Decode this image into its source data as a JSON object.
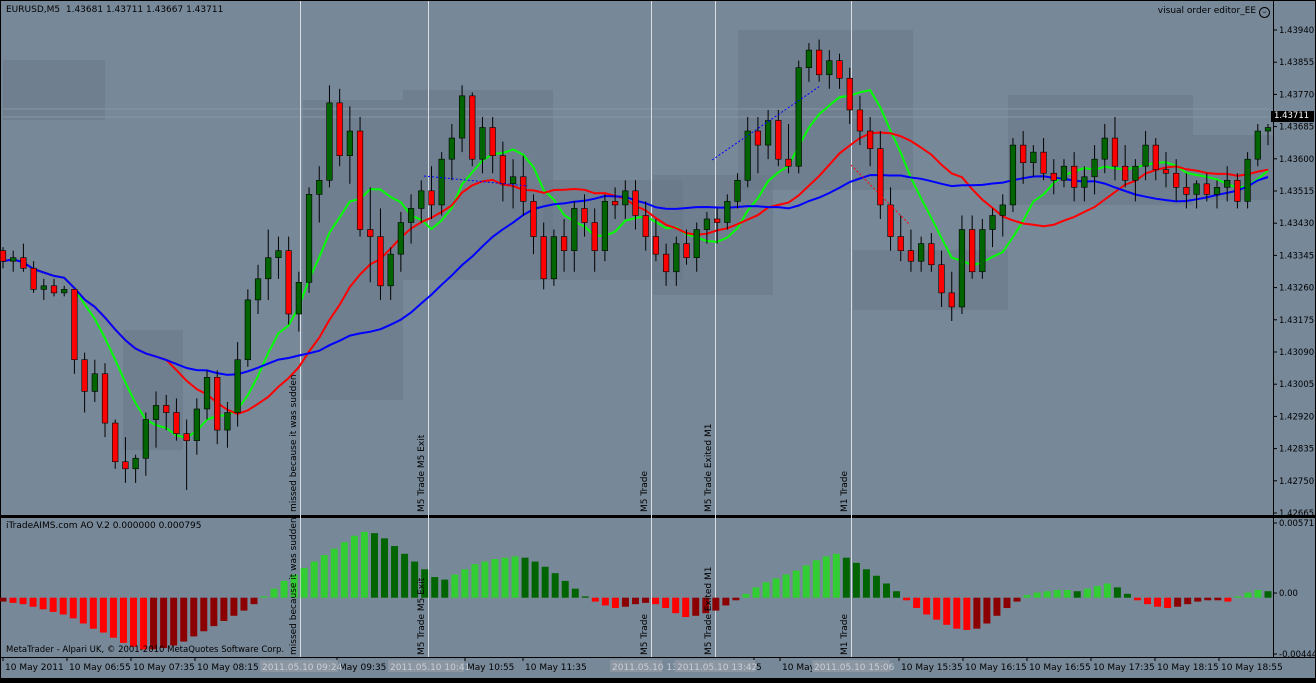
{
  "chart_header": {
    "symbol": "EURUSD,M5",
    "ohlc": "1.43681 1.43711 1.43667 1.43711",
    "editor_label": "visual order editor_EE",
    "editor_icon": "smiley-icon"
  },
  "indicator_header": "iTradeAIMS.com AO V.2 0.000000 0.000795",
  "copyright": "MetaTrader - Alpari UK, © 2001-2010 MetaQuotes Software Corp.",
  "current_price": "1.43711",
  "colors": {
    "background": "#778899",
    "bull_candle": "#006400",
    "bear_candle": "#ff0000",
    "green_ma": "#00ff00",
    "red_ma": "#ff0000",
    "blue_ma": "#0000ff",
    "ao_up": "#32cd32",
    "ao_up_dark": "#006400",
    "ao_down": "#ff0000",
    "ao_down_dark": "#8b0000",
    "zone": "#6a7888"
  },
  "price_axis": {
    "ticks": [
      "1.43940",
      "1.43855",
      "1.43770",
      "1.43685",
      "1.43600",
      "1.43515",
      "1.43430",
      "1.43345",
      "1.43260",
      "1.43175",
      "1.43090",
      "1.43005",
      "1.42920",
      "1.42835",
      "1.42750",
      "1.42665"
    ]
  },
  "ao_axis": {
    "ticks": [
      "0.00571",
      "0.00",
      "-0.00444"
    ]
  },
  "time_axis": {
    "labels": [
      "10 May 2011",
      "10 May 06:55",
      "10 May 07:35",
      "10 May 08:15",
      "May 09:35",
      "May 10:55",
      "10 May 11:35",
      "5",
      "10 May 1",
      "10 May 15:35",
      "10 May 16:15",
      "10 May 16:55",
      "10 May 17:35",
      "10 May 18:15",
      "10 May 18:55"
    ],
    "stamps": [
      "2011.05.10 09:24",
      "2011.05.10 10:41",
      "2011.05.10 13",
      "2011.05.10 13:42",
      "2011.05.10 15:06"
    ]
  },
  "annotations": {
    "vlines": [
      {
        "label": "missed because it was sudden"
      },
      {
        "label": "M5 Trade M5 Exit"
      },
      {
        "label": "M5 Trade"
      },
      {
        "label": "M5 Trade Exited M1"
      },
      {
        "label": "M1 Trade"
      }
    ]
  },
  "chart_data": [
    {
      "type": "candlestick",
      "symbol": "EURUSD",
      "timeframe": "M5",
      "title": "EURUSD,M5",
      "ylim": [
        1.4262,
        1.4399
      ],
      "series": [
        {
          "name": "OHLC",
          "values": [
            [
              1.4336,
              1.4337,
              1.4331,
              1.4333
            ],
            [
              1.4333,
              1.4336,
              1.433,
              1.4334
            ],
            [
              1.4334,
              1.4338,
              1.433,
              1.4331
            ],
            [
              1.4331,
              1.4333,
              1.4324,
              1.4325
            ],
            [
              1.4325,
              1.4328,
              1.4322,
              1.4326
            ],
            [
              1.4326,
              1.4328,
              1.4323,
              1.4324
            ],
            [
              1.4324,
              1.4326,
              1.4323,
              1.4325
            ],
            [
              1.4325,
              1.4325,
              1.4301,
              1.4305
            ],
            [
              1.4305,
              1.4307,
              1.429,
              1.4296
            ],
            [
              1.4296,
              1.4305,
              1.4293,
              1.4301
            ],
            [
              1.4301,
              1.4304,
              1.4283,
              1.4287
            ],
            [
              1.4287,
              1.4288,
              1.4274,
              1.4276
            ],
            [
              1.4276,
              1.4283,
              1.427,
              1.4274
            ],
            [
              1.4274,
              1.4278,
              1.427,
              1.4277
            ],
            [
              1.4277,
              1.429,
              1.4272,
              1.4288
            ],
            [
              1.4288,
              1.4296,
              1.428,
              1.4292
            ],
            [
              1.4292,
              1.4295,
              1.4285,
              1.429
            ],
            [
              1.429,
              1.4294,
              1.4282,
              1.4284
            ],
            [
              1.4284,
              1.4288,
              1.4268,
              1.4282
            ],
            [
              1.4282,
              1.4294,
              1.4278,
              1.4291
            ],
            [
              1.4291,
              1.4302,
              1.4288,
              1.43
            ],
            [
              1.43,
              1.4302,
              1.4281,
              1.4285
            ],
            [
              1.4285,
              1.4293,
              1.428,
              1.429
            ],
            [
              1.429,
              1.431,
              1.4286,
              1.4305
            ],
            [
              1.4305,
              1.4325,
              1.4303,
              1.4322
            ],
            [
              1.4322,
              1.4332,
              1.4318,
              1.4328
            ],
            [
              1.4328,
              1.4342,
              1.4322,
              1.4334
            ],
            [
              1.4334,
              1.434,
              1.4328,
              1.4336
            ],
            [
              1.4336,
              1.434,
              1.4315,
              1.4318
            ],
            [
              1.4318,
              1.433,
              1.4313,
              1.4327
            ],
            [
              1.4327,
              1.4354,
              1.4324,
              1.4352
            ],
            [
              1.4352,
              1.436,
              1.4344,
              1.4356
            ],
            [
              1.4356,
              1.4383,
              1.4354,
              1.4378
            ],
            [
              1.4378,
              1.4382,
              1.436,
              1.4363
            ],
            [
              1.4363,
              1.4377,
              1.4355,
              1.437
            ],
            [
              1.437,
              1.4374,
              1.434,
              1.4342
            ],
            [
              1.4342,
              1.4354,
              1.4327,
              1.434
            ],
            [
              1.434,
              1.4348,
              1.4322,
              1.4326
            ],
            [
              1.4326,
              1.4337,
              1.4322,
              1.4335
            ],
            [
              1.4335,
              1.4347,
              1.433,
              1.4344
            ],
            [
              1.4344,
              1.4352,
              1.4338,
              1.4348
            ],
            [
              1.4348,
              1.4356,
              1.4344,
              1.4353
            ],
            [
              1.4353,
              1.436,
              1.4345,
              1.4349
            ],
            [
              1.4349,
              1.4364,
              1.4346,
              1.4362
            ],
            [
              1.4362,
              1.4372,
              1.4356,
              1.4368
            ],
            [
              1.4368,
              1.4383,
              1.4364,
              1.438
            ],
            [
              1.438,
              1.4381,
              1.436,
              1.4362
            ],
            [
              1.4362,
              1.4374,
              1.4358,
              1.4371
            ],
            [
              1.4371,
              1.4374,
              1.4358,
              1.4363
            ],
            [
              1.4363,
              1.4367,
              1.435,
              1.4355
            ],
            [
              1.4355,
              1.4362,
              1.4348,
              1.4357
            ],
            [
              1.4357,
              1.4363,
              1.4346,
              1.435
            ],
            [
              1.435,
              1.4352,
              1.4335,
              1.434
            ],
            [
              1.434,
              1.4344,
              1.4325,
              1.4328
            ],
            [
              1.4328,
              1.4342,
              1.4326,
              1.434
            ],
            [
              1.434,
              1.4345,
              1.433,
              1.4336
            ],
            [
              1.4336,
              1.435,
              1.433,
              1.4348
            ],
            [
              1.4348,
              1.4352,
              1.434,
              1.4344
            ],
            [
              1.4344,
              1.4348,
              1.433,
              1.4336
            ],
            [
              1.4336,
              1.4352,
              1.4333,
              1.435
            ],
            [
              1.435,
              1.4354,
              1.4345,
              1.4349
            ],
            [
              1.4349,
              1.4356,
              1.4345,
              1.4353
            ],
            [
              1.4353,
              1.4356,
              1.4342,
              1.4346
            ],
            [
              1.4346,
              1.435,
              1.4336,
              1.434
            ],
            [
              1.434,
              1.4345,
              1.4333,
              1.4335
            ],
            [
              1.4335,
              1.4338,
              1.4326,
              1.433
            ],
            [
              1.433,
              1.434,
              1.4326,
              1.4338
            ],
            [
              1.4338,
              1.4342,
              1.4332,
              1.4334
            ],
            [
              1.4334,
              1.4344,
              1.433,
              1.4342
            ],
            [
              1.4342,
              1.4347,
              1.4338,
              1.4345
            ],
            [
              1.4345,
              1.4348,
              1.4338,
              1.4344
            ],
            [
              1.4344,
              1.4352,
              1.4342,
              1.435
            ],
            [
              1.435,
              1.4358,
              1.4348,
              1.4356
            ],
            [
              1.4356,
              1.4374,
              1.4354,
              1.437
            ],
            [
              1.437,
              1.4374,
              1.4358,
              1.4366
            ],
            [
              1.4366,
              1.4376,
              1.4362,
              1.4373
            ],
            [
              1.4373,
              1.4376,
              1.436,
              1.4362
            ],
            [
              1.4362,
              1.4372,
              1.4358,
              1.436
            ],
            [
              1.436,
              1.439,
              1.4358,
              1.4388
            ],
            [
              1.4388,
              1.4395,
              1.4384,
              1.4393
            ],
            [
              1.4393,
              1.4396,
              1.4384,
              1.4386
            ],
            [
              1.4386,
              1.4393,
              1.4382,
              1.439
            ],
            [
              1.439,
              1.4392,
              1.4382,
              1.4385
            ],
            [
              1.4385,
              1.4388,
              1.4372,
              1.4376
            ],
            [
              1.4376,
              1.438,
              1.4366,
              1.437
            ],
            [
              1.437,
              1.4374,
              1.436,
              1.4365
            ],
            [
              1.4365,
              1.437,
              1.4345,
              1.4349
            ],
            [
              1.4349,
              1.4354,
              1.4336,
              1.434
            ],
            [
              1.434,
              1.4346,
              1.4333,
              1.4336
            ],
            [
              1.4336,
              1.4342,
              1.433,
              1.4333
            ],
            [
              1.4333,
              1.434,
              1.433,
              1.4338
            ],
            [
              1.4338,
              1.4341,
              1.433,
              1.4332
            ],
            [
              1.4332,
              1.4336,
              1.432,
              1.4324
            ],
            [
              1.4324,
              1.433,
              1.4316,
              1.432
            ],
            [
              1.432,
              1.4346,
              1.4318,
              1.4342
            ],
            [
              1.4342,
              1.4346,
              1.4328,
              1.433
            ],
            [
              1.433,
              1.4345,
              1.4328,
              1.4342
            ],
            [
              1.4342,
              1.4348,
              1.4337,
              1.4346
            ],
            [
              1.4346,
              1.4352,
              1.434,
              1.4349
            ],
            [
              1.4349,
              1.4368,
              1.4347,
              1.4366
            ],
            [
              1.4366,
              1.437,
              1.4355,
              1.4361
            ],
            [
              1.4361,
              1.4366,
              1.4357,
              1.4364
            ],
            [
              1.4364,
              1.4368,
              1.4356,
              1.4358
            ],
            [
              1.4358,
              1.4362,
              1.4352,
              1.4356
            ],
            [
              1.4356,
              1.4362,
              1.4354,
              1.436
            ],
            [
              1.436,
              1.4364,
              1.435,
              1.4354
            ],
            [
              1.4354,
              1.436,
              1.435,
              1.4357
            ],
            [
              1.4357,
              1.4366,
              1.4352,
              1.4362
            ],
            [
              1.4362,
              1.4372,
              1.4358,
              1.4368
            ],
            [
              1.4368,
              1.4374,
              1.4356,
              1.436
            ],
            [
              1.436,
              1.4366,
              1.4354,
              1.4356
            ],
            [
              1.4356,
              1.4362,
              1.435,
              1.436
            ],
            [
              1.436,
              1.437,
              1.4356,
              1.4366
            ],
            [
              1.4366,
              1.4368,
              1.4356,
              1.4359
            ],
            [
              1.4359,
              1.4364,
              1.4354,
              1.4358
            ],
            [
              1.4358,
              1.4362,
              1.435,
              1.4354
            ],
            [
              1.4354,
              1.4358,
              1.4348,
              1.4352
            ],
            [
              1.4352,
              1.4356,
              1.4348,
              1.4355
            ],
            [
              1.4355,
              1.4358,
              1.435,
              1.4352
            ],
            [
              1.4352,
              1.4356,
              1.4348,
              1.4354
            ],
            [
              1.4354,
              1.436,
              1.435,
              1.4356
            ],
            [
              1.4356,
              1.4358,
              1.4348,
              1.435
            ],
            [
              1.435,
              1.4364,
              1.4348,
              1.4362
            ],
            [
              1.4362,
              1.4372,
              1.436,
              1.437
            ],
            [
              1.437,
              1.4372,
              1.4366,
              1.4371
            ]
          ]
        }
      ]
    },
    {
      "type": "bar",
      "title": "iTradeAIMS.com AO V.2",
      "ylim": [
        -0.00444,
        0.00571
      ],
      "series": [
        {
          "name": "AO",
          "values": [
            -0.0003,
            -0.0004,
            -0.0005,
            -0.0007,
            -0.0009,
            -0.0011,
            -0.0013,
            -0.0016,
            -0.002,
            -0.0024,
            -0.0027,
            -0.0031,
            -0.0035,
            -0.0038,
            -0.004,
            -0.004,
            -0.0039,
            -0.0037,
            -0.0034,
            -0.003,
            -0.0026,
            -0.0022,
            -0.0018,
            -0.0014,
            -0.001,
            -0.0005,
            0.0001,
            0.0007,
            0.0013,
            0.0018,
            0.0023,
            0.0028,
            0.0033,
            0.0038,
            0.0043,
            0.0048,
            0.0051,
            0.005,
            0.0046,
            0.004,
            0.0034,
            0.0028,
            0.0022,
            0.0016,
            0.0014,
            0.0018,
            0.0022,
            0.0026,
            0.0028,
            0.003,
            0.0031,
            0.0032,
            0.0031,
            0.0028,
            0.0024,
            0.0019,
            0.0013,
            0.0007,
            0.0001,
            -0.0003,
            -0.0006,
            -0.0008,
            -0.0007,
            -0.0005,
            -0.0004,
            -0.0005,
            -0.0008,
            -0.0012,
            -0.0015,
            -0.0014,
            -0.0012,
            -0.001,
            -0.0006,
            -0.0002,
            0.0003,
            0.0008,
            0.0012,
            0.0015,
            0.0018,
            0.0021,
            0.0025,
            0.0029,
            0.0032,
            0.0034,
            0.0031,
            0.0027,
            0.0022,
            0.0017,
            0.0011,
            0.0005,
            -0.0002,
            -0.0008,
            -0.0013,
            -0.0017,
            -0.0021,
            -0.0024,
            -0.0025,
            -0.0024,
            -0.002,
            -0.0014,
            -0.0008,
            -0.0003,
            0.0002,
            0.0004,
            0.0005,
            0.0006,
            0.0006,
            0.0005,
            0.0007,
            0.0009,
            0.0011,
            0.0008,
            0.0003,
            -0.0002,
            -0.0005,
            -0.0007,
            -0.0008,
            -0.0007,
            -0.0005,
            -0.0003,
            -0.0002,
            -0.0002,
            -0.0003,
            0.0001,
            0.0004,
            0.0006,
            0.0005
          ]
        }
      ]
    }
  ]
}
